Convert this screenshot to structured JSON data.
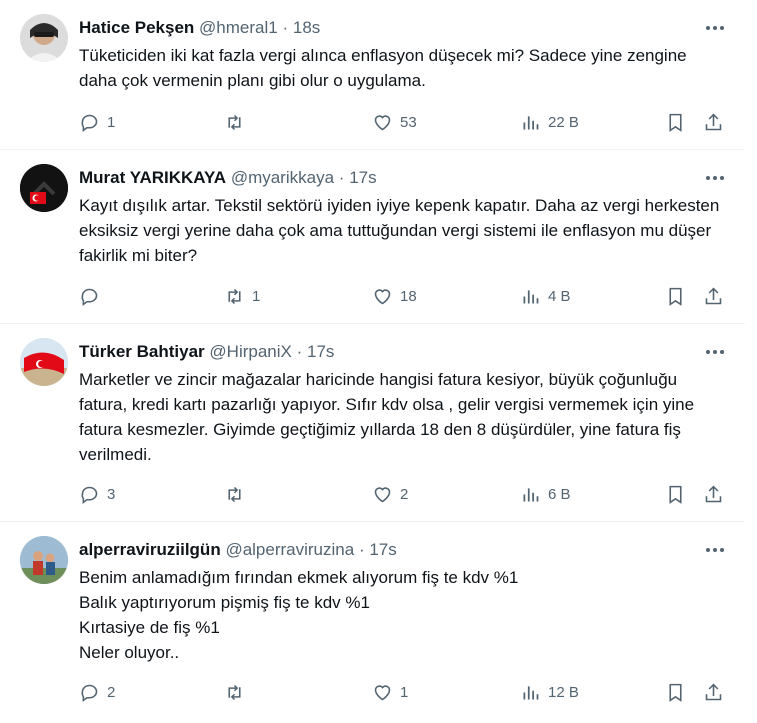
{
  "tweets": [
    {
      "name": "Hatice Pekşen",
      "handle": "@hmeral1",
      "time": "18s",
      "text": "Tüketiciden iki kat fazla vergi alınca enflasyon düşecek mi? Sadece yine zengine daha çok vermenin planı gibi olur o uygulama.",
      "replies": "1",
      "retweets": "",
      "likes": "53",
      "views": "22 B"
    },
    {
      "name": "Murat YARIKKAYA",
      "handle": "@myarikkaya",
      "time": "17s",
      "text": "Kayıt dışılık artar. Tekstil sektörü iyiden iyiye kepenk kapatır. Daha az vergi herkesten eksiksiz vergi yerine daha çok ama tuttuğundan vergi sistemi ile enflasyon mu düşer fakirlik mi biter?",
      "replies": "",
      "retweets": "1",
      "likes": "18",
      "views": "4 B"
    },
    {
      "name": "Türker Bahtiyar",
      "handle": "@HirpaniX",
      "time": "17s",
      "text": "Marketler ve zincir mağazalar haricinde hangisi fatura kesiyor, büyük çoğunluğu fatura, kredi kartı pazarlığı yapıyor. Sıfır kdv olsa , gelir vergisi vermemek için yine fatura kesmezler.  Giyimde geçtiğimiz yıllarda 18 den 8 düşürdüler, yine fatura fiş verilmedi.",
      "replies": "3",
      "retweets": "",
      "likes": "2",
      "views": "6 B"
    },
    {
      "name": "alperraviruziilgün",
      "handle": "@alperraviruzina",
      "time": "17s",
      "text": "Benim anlamadığım fırından ekmek alıyorum fiş te kdv %1\nBalık yaptırıyorum pişmiş fiş te kdv %1\nKırtasiye de fiş  %1\nNeler oluyor..",
      "replies": "2",
      "retweets": "",
      "likes": "1",
      "views": "12 B"
    }
  ],
  "colors": {
    "text": "#0f1419",
    "secondary": "#536471",
    "divider": "#eff3f4"
  },
  "icons": [
    "more-icon",
    "reply-icon",
    "retweet-icon",
    "like-icon",
    "views-icon",
    "bookmark-icon",
    "share-icon"
  ]
}
